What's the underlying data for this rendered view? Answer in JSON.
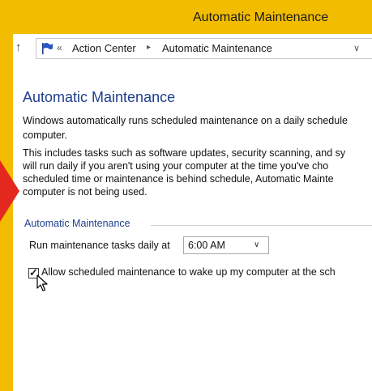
{
  "window": {
    "title": "Automatic Maintenance"
  },
  "address_bar": {
    "separator_glyph": "«",
    "breadcrumbs": [
      "Action Center",
      "Automatic Maintenance"
    ],
    "crumb_separator": "▸"
  },
  "content": {
    "heading": "Automatic Maintenance",
    "description_lines": [
      "Windows automatically runs scheduled maintenance on a daily schedule",
      "computer."
    ],
    "details_lines": [
      "This includes tasks such as software updates, security scanning, and sy",
      "will run daily if you aren't using your computer at the time you've cho",
      "scheduled time or maintenance is behind schedule, Automatic Mainte",
      "computer is not being used."
    ],
    "section_label": "Automatic Maintenance",
    "run_label": "Run maintenance tasks daily at",
    "time_select_value": "6:00 AM",
    "wake_checkbox_checked": true,
    "wake_label": "Allow scheduled maintenance to wake up my computer at the sch"
  },
  "colors": {
    "frame": "#f2bc00",
    "heading": "#1e3f8c",
    "annotation_arrow": "#e3281f"
  },
  "icons": {
    "up": "up-arrow-icon",
    "location": "action-center-flag-icon",
    "dropdown": "chevron-down-icon",
    "pointer": "mouse-pointer-icon"
  }
}
